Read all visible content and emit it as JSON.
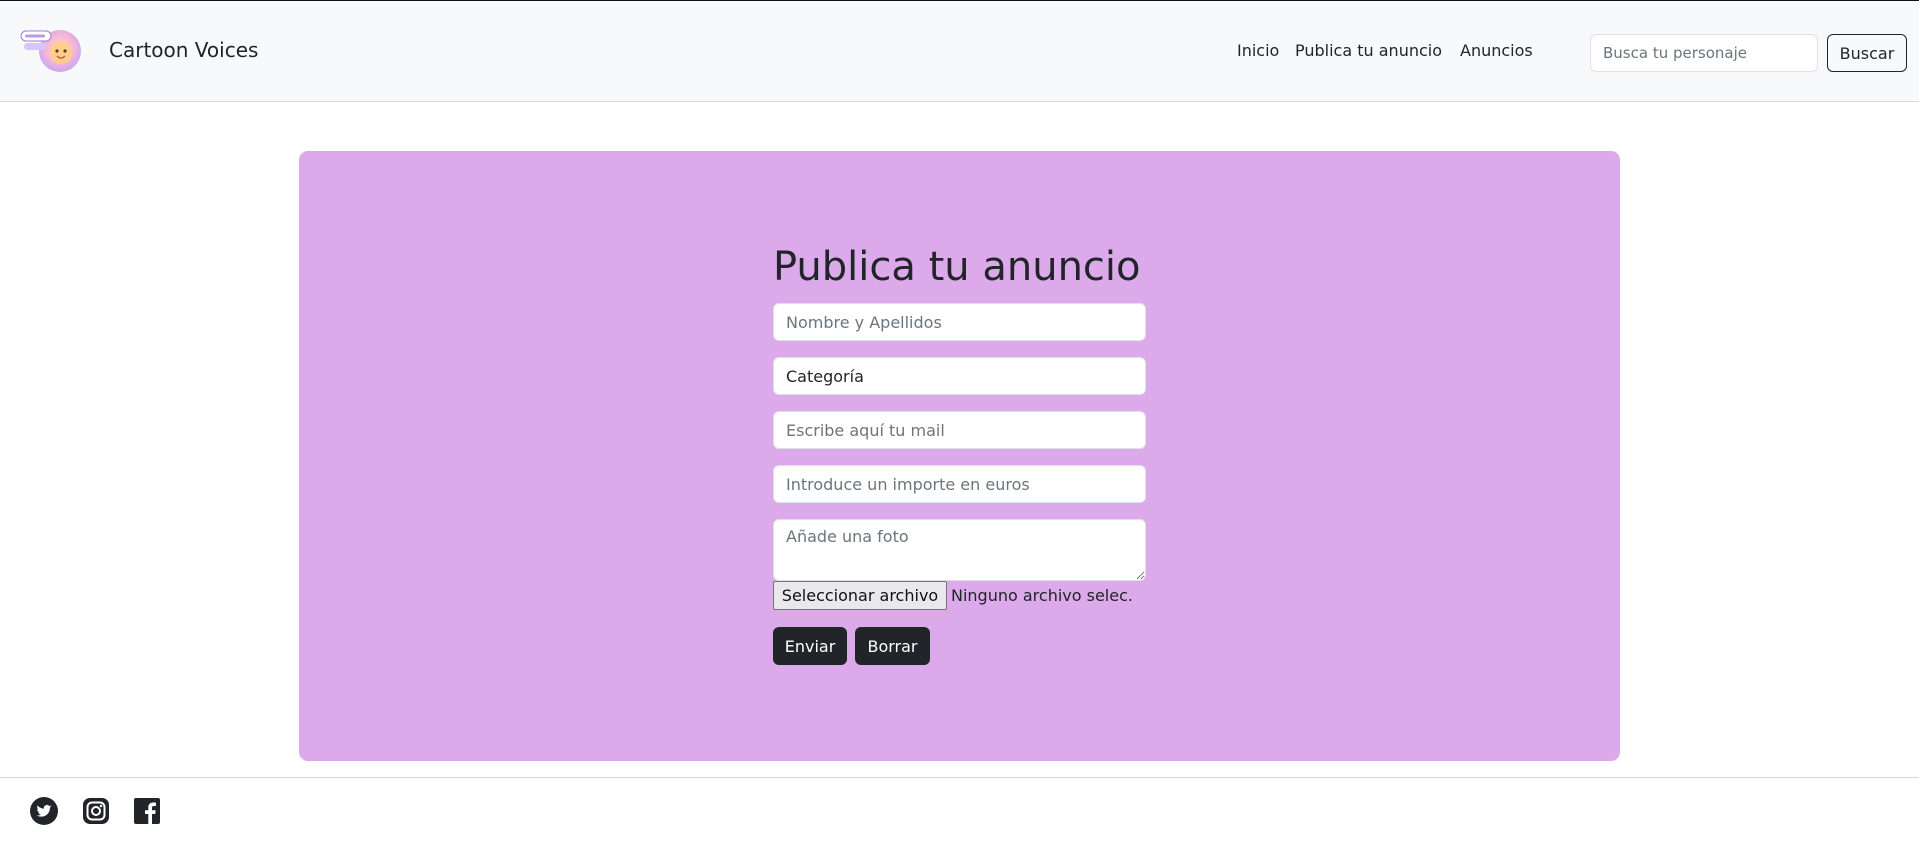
{
  "brand": {
    "name": "Cartoon Voices",
    "logo_icon": "cartoon-face-logo-icon"
  },
  "nav": {
    "items": [
      {
        "label": "Inicio"
      },
      {
        "label": "Publica tu anuncio"
      },
      {
        "label": "Anuncios"
      }
    ]
  },
  "search": {
    "placeholder": "Busca tu personaje",
    "button_label": "Buscar"
  },
  "form": {
    "title": "Publica tu anuncio",
    "name_placeholder": "Nombre y Apellidos",
    "category_value": "Categoría",
    "email_placeholder": "Escribe aquí tu mail",
    "amount_placeholder": "Introduce un importe en euros",
    "photo_placeholder": "Añade una foto",
    "file_button_label": "Seleccionar archivo",
    "file_status": "Ninguno archivo selec.",
    "submit_label": "Enviar",
    "reset_label": "Borrar"
  },
  "footer": {
    "social_icons": [
      "twitter-icon",
      "instagram-icon",
      "facebook-icon"
    ]
  },
  "colors": {
    "navbar_bg": "#f8f9fa",
    "panel_bg": "#dcaaea",
    "dark_button": "#212529",
    "text": "#212529"
  }
}
